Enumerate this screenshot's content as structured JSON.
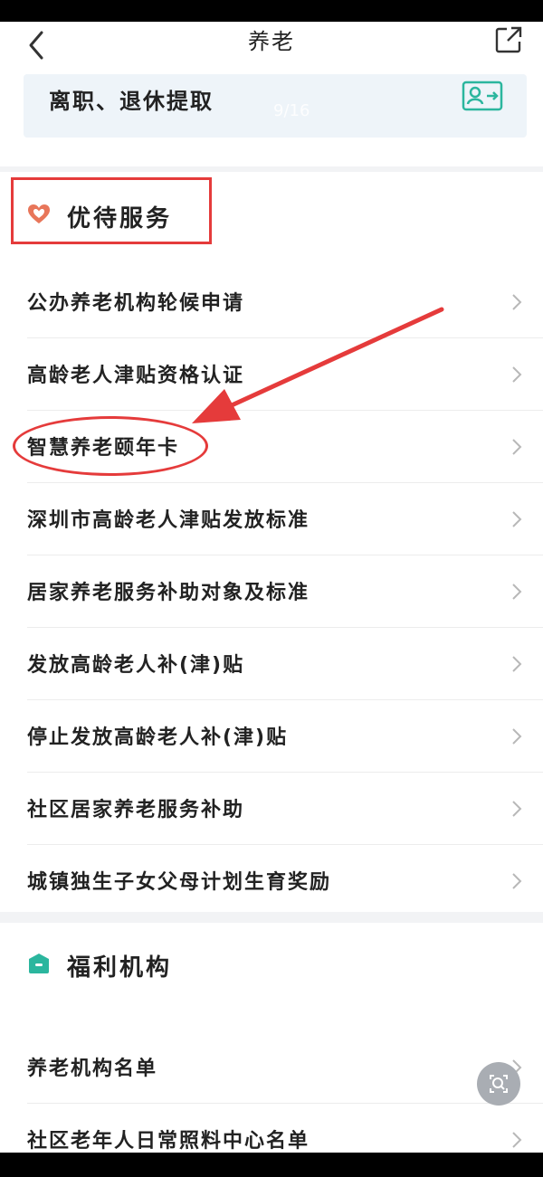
{
  "navbar": {
    "title": "养老",
    "back_icon": "chevron-left-icon",
    "share_icon": "share-external-icon"
  },
  "top_card": {
    "label": "离职、退休提取",
    "page_indicator": "9/16",
    "icon": "id-card-transfer-icon"
  },
  "section_benefits": {
    "title": "优待服务",
    "icon": "heart-icon",
    "icon_color": "#e8765a",
    "items": [
      {
        "label": "公办养老机构轮候申请"
      },
      {
        "label": "高龄老人津贴资格认证"
      },
      {
        "label": "智慧养老颐年卡"
      },
      {
        "label": "深圳市高龄老人津贴发放标准"
      },
      {
        "label": "居家养老服务补助对象及标准"
      },
      {
        "label": "发放高龄老人补(津)贴"
      },
      {
        "label": "停止发放高龄老人补(津)贴"
      },
      {
        "label": "社区居家养老服务补助"
      },
      {
        "label": "城镇独生子女父母计划生育奖励"
      }
    ]
  },
  "section_welfare": {
    "title": "福利机构",
    "icon": "house-icon",
    "icon_color": "#2bb69e",
    "items": [
      {
        "label": "养老机构名单"
      },
      {
        "label": "社区老年人日常照料中心名单"
      }
    ]
  },
  "annotation_color": "#e53b3b",
  "accent_color": "#2bb69e",
  "floating_button_icon": "search-zoom-icon"
}
